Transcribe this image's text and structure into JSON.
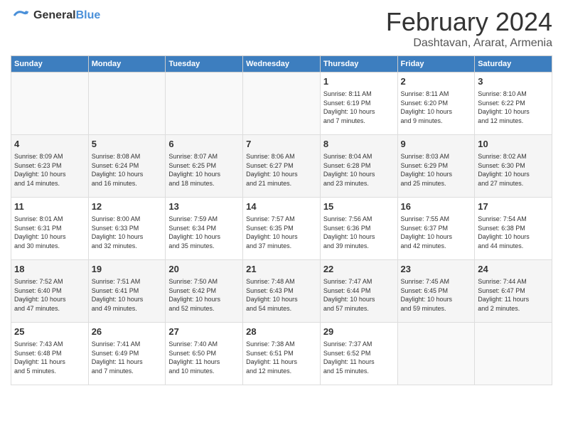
{
  "header": {
    "logo_general": "General",
    "logo_blue": "Blue",
    "month_year": "February 2024",
    "location": "Dashtavan, Ararat, Armenia"
  },
  "weekdays": [
    "Sunday",
    "Monday",
    "Tuesday",
    "Wednesday",
    "Thursday",
    "Friday",
    "Saturday"
  ],
  "weeks": [
    [
      {
        "day": "",
        "info": ""
      },
      {
        "day": "",
        "info": ""
      },
      {
        "day": "",
        "info": ""
      },
      {
        "day": "",
        "info": ""
      },
      {
        "day": "1",
        "info": "Sunrise: 8:11 AM\nSunset: 6:19 PM\nDaylight: 10 hours\nand 7 minutes."
      },
      {
        "day": "2",
        "info": "Sunrise: 8:11 AM\nSunset: 6:20 PM\nDaylight: 10 hours\nand 9 minutes."
      },
      {
        "day": "3",
        "info": "Sunrise: 8:10 AM\nSunset: 6:22 PM\nDaylight: 10 hours\nand 12 minutes."
      }
    ],
    [
      {
        "day": "4",
        "info": "Sunrise: 8:09 AM\nSunset: 6:23 PM\nDaylight: 10 hours\nand 14 minutes."
      },
      {
        "day": "5",
        "info": "Sunrise: 8:08 AM\nSunset: 6:24 PM\nDaylight: 10 hours\nand 16 minutes."
      },
      {
        "day": "6",
        "info": "Sunrise: 8:07 AM\nSunset: 6:25 PM\nDaylight: 10 hours\nand 18 minutes."
      },
      {
        "day": "7",
        "info": "Sunrise: 8:06 AM\nSunset: 6:27 PM\nDaylight: 10 hours\nand 21 minutes."
      },
      {
        "day": "8",
        "info": "Sunrise: 8:04 AM\nSunset: 6:28 PM\nDaylight: 10 hours\nand 23 minutes."
      },
      {
        "day": "9",
        "info": "Sunrise: 8:03 AM\nSunset: 6:29 PM\nDaylight: 10 hours\nand 25 minutes."
      },
      {
        "day": "10",
        "info": "Sunrise: 8:02 AM\nSunset: 6:30 PM\nDaylight: 10 hours\nand 27 minutes."
      }
    ],
    [
      {
        "day": "11",
        "info": "Sunrise: 8:01 AM\nSunset: 6:31 PM\nDaylight: 10 hours\nand 30 minutes."
      },
      {
        "day": "12",
        "info": "Sunrise: 8:00 AM\nSunset: 6:33 PM\nDaylight: 10 hours\nand 32 minutes."
      },
      {
        "day": "13",
        "info": "Sunrise: 7:59 AM\nSunset: 6:34 PM\nDaylight: 10 hours\nand 35 minutes."
      },
      {
        "day": "14",
        "info": "Sunrise: 7:57 AM\nSunset: 6:35 PM\nDaylight: 10 hours\nand 37 minutes."
      },
      {
        "day": "15",
        "info": "Sunrise: 7:56 AM\nSunset: 6:36 PM\nDaylight: 10 hours\nand 39 minutes."
      },
      {
        "day": "16",
        "info": "Sunrise: 7:55 AM\nSunset: 6:37 PM\nDaylight: 10 hours\nand 42 minutes."
      },
      {
        "day": "17",
        "info": "Sunrise: 7:54 AM\nSunset: 6:38 PM\nDaylight: 10 hours\nand 44 minutes."
      }
    ],
    [
      {
        "day": "18",
        "info": "Sunrise: 7:52 AM\nSunset: 6:40 PM\nDaylight: 10 hours\nand 47 minutes."
      },
      {
        "day": "19",
        "info": "Sunrise: 7:51 AM\nSunset: 6:41 PM\nDaylight: 10 hours\nand 49 minutes."
      },
      {
        "day": "20",
        "info": "Sunrise: 7:50 AM\nSunset: 6:42 PM\nDaylight: 10 hours\nand 52 minutes."
      },
      {
        "day": "21",
        "info": "Sunrise: 7:48 AM\nSunset: 6:43 PM\nDaylight: 10 hours\nand 54 minutes."
      },
      {
        "day": "22",
        "info": "Sunrise: 7:47 AM\nSunset: 6:44 PM\nDaylight: 10 hours\nand 57 minutes."
      },
      {
        "day": "23",
        "info": "Sunrise: 7:45 AM\nSunset: 6:45 PM\nDaylight: 10 hours\nand 59 minutes."
      },
      {
        "day": "24",
        "info": "Sunrise: 7:44 AM\nSunset: 6:47 PM\nDaylight: 11 hours\nand 2 minutes."
      }
    ],
    [
      {
        "day": "25",
        "info": "Sunrise: 7:43 AM\nSunset: 6:48 PM\nDaylight: 11 hours\nand 5 minutes."
      },
      {
        "day": "26",
        "info": "Sunrise: 7:41 AM\nSunset: 6:49 PM\nDaylight: 11 hours\nand 7 minutes."
      },
      {
        "day": "27",
        "info": "Sunrise: 7:40 AM\nSunset: 6:50 PM\nDaylight: 11 hours\nand 10 minutes."
      },
      {
        "day": "28",
        "info": "Sunrise: 7:38 AM\nSunset: 6:51 PM\nDaylight: 11 hours\nand 12 minutes."
      },
      {
        "day": "29",
        "info": "Sunrise: 7:37 AM\nSunset: 6:52 PM\nDaylight: 11 hours\nand 15 minutes."
      },
      {
        "day": "",
        "info": ""
      },
      {
        "day": "",
        "info": ""
      }
    ]
  ]
}
